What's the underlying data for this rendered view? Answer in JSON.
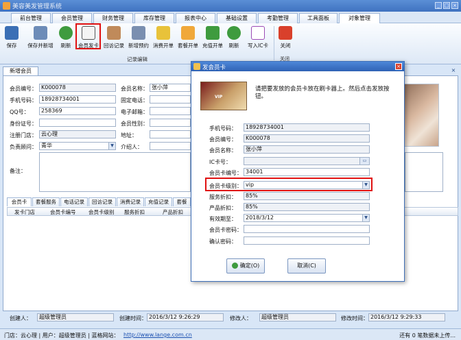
{
  "window": {
    "title": "美容美发管理系统"
  },
  "menu_tabs": [
    "前台管理",
    "会员管理",
    "财务管理",
    "库存管理",
    "报表中心",
    "基础设置",
    "考勤管理",
    "工具面板",
    "对象管理"
  ],
  "ribbon": {
    "buttons": [
      "保存",
      "保存并新增",
      "刷新",
      "会员发卡",
      "回访记录",
      "新增预约",
      "消费开单",
      "套餐开单",
      "充值开单",
      "刷新",
      "写入IC卡",
      "关闭"
    ],
    "group_label": "记录编辑",
    "group_label2": "关闭"
  },
  "doc_tab": "新增会员",
  "form": {
    "member_no_label": "会员编号：",
    "member_no": "K000078",
    "member_name_label": "会员名称：",
    "member_name": "张小萍",
    "phone_label": "手机号码：",
    "phone": "18928734001",
    "tel_label": "固定电话：",
    "tel": "",
    "qq_label": "QQ号：",
    "qq": "258369",
    "email_label": "电子邮箱：",
    "email": "",
    "id_label": "身份证号：",
    "id": "",
    "gender_label": "会员性别：",
    "gender": "",
    "store_label": "注册门店：",
    "store": "云心理",
    "address_label": "地址：",
    "address": "",
    "consultant_label": "负责顾问：",
    "consultant": "青华",
    "referrer_label": "介绍人：",
    "referrer": "",
    "remark_label": "备注：",
    "remark": ""
  },
  "sub_tabs": [
    "会员卡",
    "套餐服务",
    "电话记录",
    "回访记录",
    "消费记录",
    "充值记录",
    "套餐"
  ],
  "grid_headers": [
    "发卡门店",
    "会员卡编号",
    "会员卡级别",
    "服务折扣",
    "产品折扣"
  ],
  "info": {
    "creator_label": "创建人：",
    "creator": "超级管理员",
    "created_label": "创建时间：",
    "created": "2016/3/12 9:26:29",
    "modifier_label": "修改人：",
    "modifier": "超级管理员",
    "modified_label": "修改时间：",
    "modified": "2016/3/12 9:29:33"
  },
  "status": {
    "text": "门店：云心理 | 用户：超级管理员 | 蓝格网站：",
    "url": "http://www.lange.com.cn",
    "right": "还有 0 笔数据未上传..."
  },
  "dialog": {
    "title": "发会员卡",
    "prompt": "请把要发放的会员卡放在刷卡器上。然后点击发放按钮。",
    "card_text": "VIP",
    "fields": [
      {
        "label": "手机号码：",
        "value": "18928734001"
      },
      {
        "label": "会员编号：",
        "value": "K000078"
      },
      {
        "label": "会员名称：",
        "value": "张小萍"
      },
      {
        "label": "IC卡号：",
        "value": ""
      },
      {
        "label": "会员卡编号：",
        "value": "34001"
      },
      {
        "label": "会员卡级别：",
        "value": "vip"
      },
      {
        "label": "服务折扣：",
        "value": "85%"
      },
      {
        "label": "产品折扣：",
        "value": "85%"
      },
      {
        "label": "有效期至：",
        "value": "2018/3/12"
      },
      {
        "label": "会员卡密码：",
        "value": ""
      },
      {
        "label": "确认密码：",
        "value": ""
      }
    ],
    "ok_button": "确定(O)",
    "cancel_button": "取消(C)"
  },
  "colors": {
    "highlight": "#e01010",
    "titlebar": "#3f72c0",
    "panel_border": "#8fa9cd"
  }
}
